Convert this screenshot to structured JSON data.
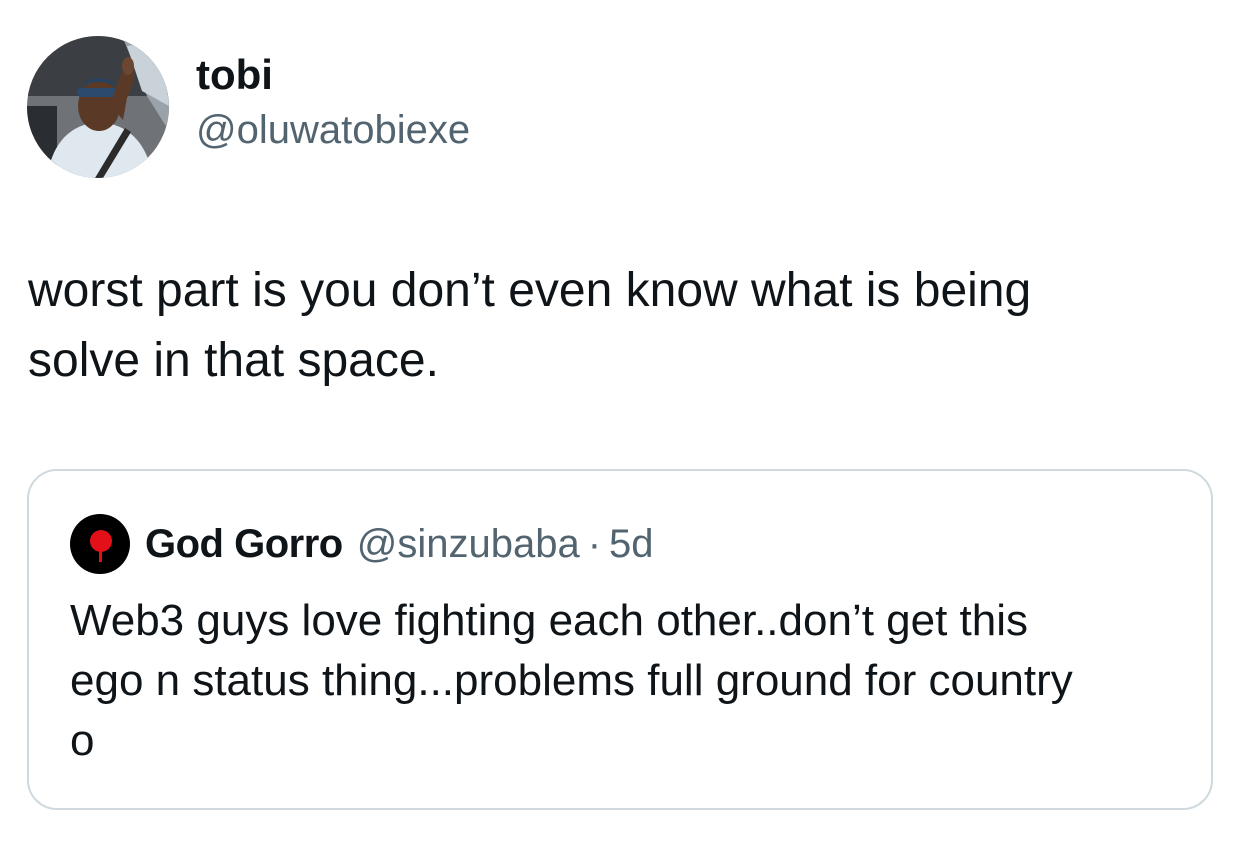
{
  "tweet": {
    "author": {
      "display_name": "tobi",
      "handle": "@oluwatobiexe",
      "avatar_icon": "profile-photo-avatar"
    },
    "text_lines": [
      "worst part is you don’t even know what is being",
      "solve in that space."
    ]
  },
  "quote": {
    "author": {
      "display_name": "God Gorro",
      "handle": "@sinzubaba",
      "separator": "·",
      "timestamp": "5d",
      "avatar_icon": "red-pin-avatar"
    },
    "text_lines": [
      "Web3 guys love fighting each other..don’t get this",
      "ego n status thing...problems full ground for country",
      "o"
    ]
  },
  "colors": {
    "text_primary": "#0f1419",
    "text_secondary": "#536471",
    "border": "#cfd9de",
    "quote_avatar_bg": "#000000",
    "quote_avatar_pin": "#e3101a"
  }
}
